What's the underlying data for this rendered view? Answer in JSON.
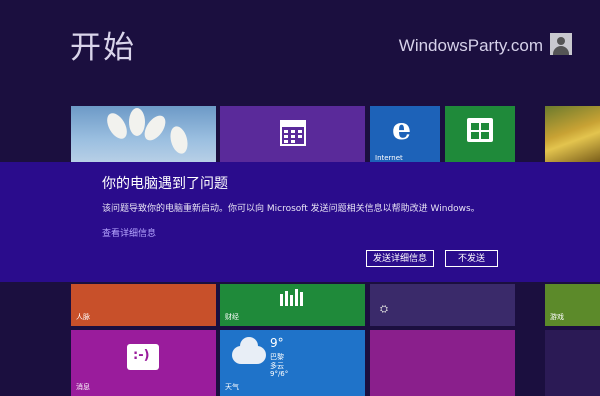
{
  "start": {
    "title": "开始"
  },
  "user": {
    "name": "WindowsParty.com"
  },
  "tiles": {
    "ie_label": "Internet",
    "people_label": "人脉",
    "finance_label": "财经",
    "games_label": "游戏",
    "messaging_label": "消息",
    "weather_label": "天气",
    "weather_temp": "9°",
    "weather_city": "巴黎",
    "weather_condition": "多云",
    "weather_range": "9°/6°"
  },
  "dialog": {
    "title": "你的电脑遇到了问题",
    "message": "该问题导致你的电脑重新启动。你可以向 Microsoft 发送问题相关信息以帮助改进 Windows。",
    "details_link": "查看详细信息",
    "send_button": "发送详细信息",
    "dont_send_button": "不发送"
  },
  "colors": {
    "background": "#1b0f3f",
    "dialog": "#2a0c8c",
    "link": "#b6a6ff"
  }
}
